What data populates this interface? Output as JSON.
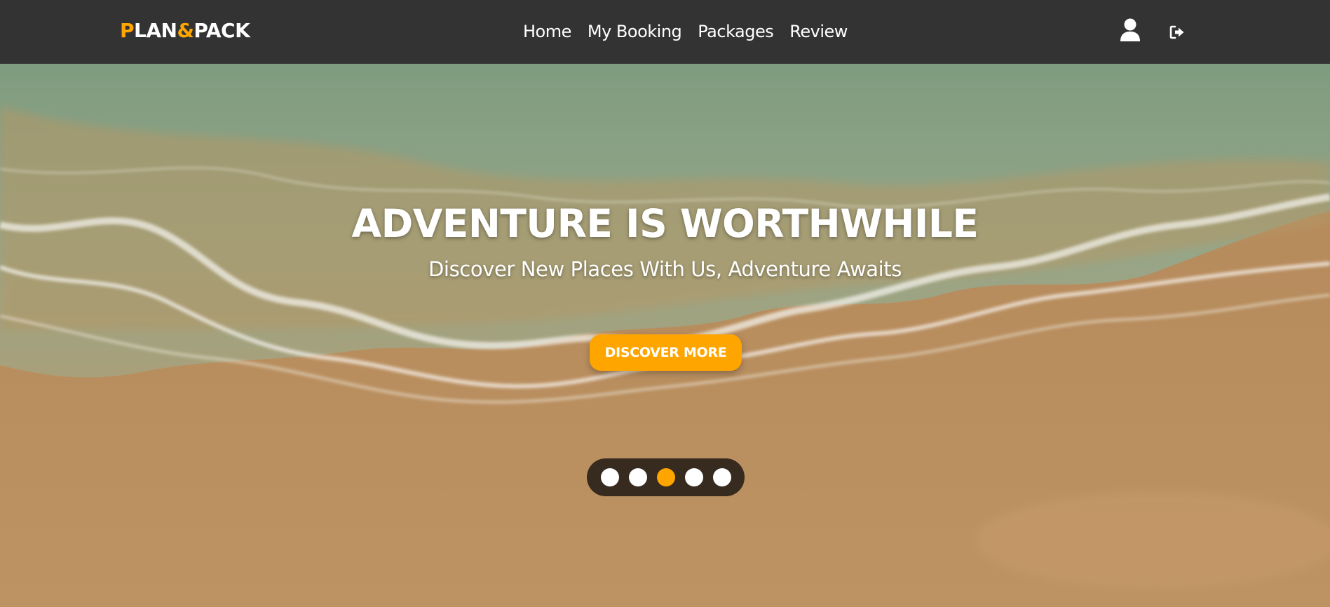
{
  "brand": {
    "part1": "P",
    "part2": "LAN",
    "part3": "&",
    "part4": "PACK",
    "accent_color": "#ffa500"
  },
  "nav": {
    "items": [
      {
        "label": "Home"
      },
      {
        "label": "My Booking"
      },
      {
        "label": "Packages"
      },
      {
        "label": "Review"
      }
    ],
    "icons": [
      "user-icon",
      "logout-icon"
    ]
  },
  "hero": {
    "title": "ADVENTURE IS WORTHWHILE",
    "subtitle": "Discover New Places With Us, Adventure Awaits",
    "cta_label": "DISCOVER MORE"
  },
  "slider": {
    "count": 5,
    "active_index": 2
  },
  "colors": {
    "navbar": "#333333",
    "accent": "#ffa500",
    "sand": "#b68a58",
    "sea": "#8aa48a"
  }
}
